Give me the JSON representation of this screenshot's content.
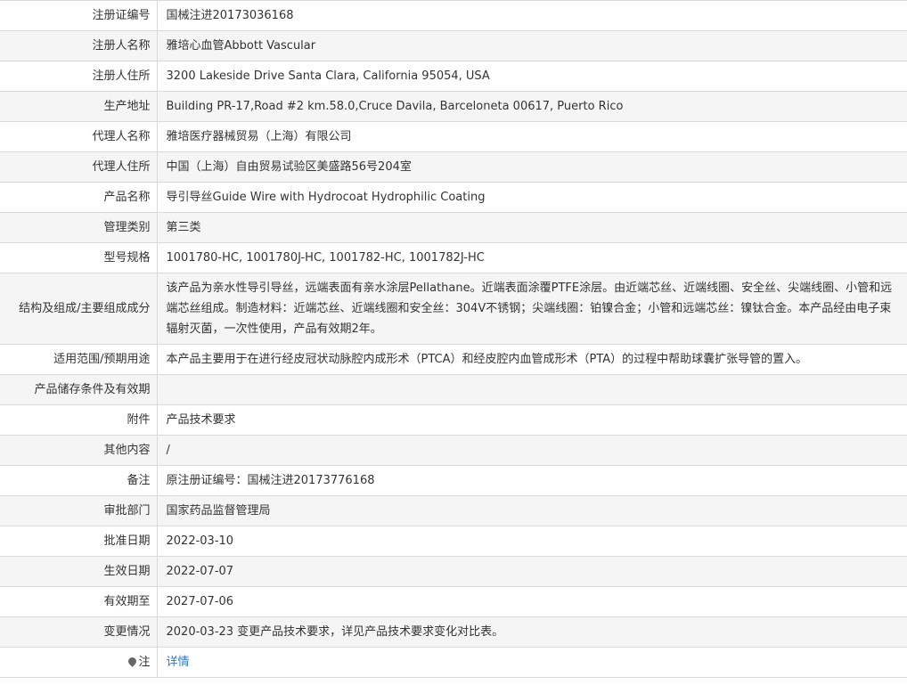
{
  "rows": [
    {
      "label": "注册证编号",
      "value": "国械注进20173036168"
    },
    {
      "label": "注册人名称",
      "value": "雅培心血管Abbott Vascular"
    },
    {
      "label": "注册人住所",
      "value": "3200 Lakeside Drive Santa Clara, California 95054, USA"
    },
    {
      "label": "生产地址",
      "value": "Building PR-17,Road #2 km.58.0,Cruce Davila, Barceloneta 00617, Puerto Rico"
    },
    {
      "label": "代理人名称",
      "value": "雅培医疗器械贸易（上海）有限公司"
    },
    {
      "label": "代理人住所",
      "value": "中国（上海）自由贸易试验区美盛路56号204室"
    },
    {
      "label": "产品名称",
      "value": "导引导丝Guide Wire with Hydrocoat Hydrophilic Coating"
    },
    {
      "label": "管理类别",
      "value": "第三类"
    },
    {
      "label": "型号规格",
      "value": "1001780-HC, 1001780J-HC, 1001782-HC, 1001782J-HC"
    },
    {
      "label": "结构及组成/主要组成成分",
      "value": "该产品为亲水性导引导丝，远端表面有亲水涂层Pellathane。近端表面涂覆PTFE涂层。由近端芯丝、近端线圈、安全丝、尖端线圈、小管和远端芯丝组成。制造材料：近端芯丝、近端线圈和安全丝：304V不锈钢；尖端线圈：铂镍合金；小管和远端芯丝：镍钛合金。本产品经由电子束辐射灭菌，一次性使用，产品有效期2年。"
    },
    {
      "label": "适用范围/预期用途",
      "value": "本产品主要用于在进行经皮冠状动脉腔内成形术（PTCA）和经皮腔内血管成形术（PTA）的过程中帮助球囊扩张导管的置入。"
    },
    {
      "label": "产品储存条件及有效期",
      "value": ""
    },
    {
      "label": "附件",
      "value": "产品技术要求"
    },
    {
      "label": "其他内容",
      "value": "/"
    },
    {
      "label": "备注",
      "value": "原注册证编号：国械注进20173776168"
    },
    {
      "label": "审批部门",
      "value": "国家药品监督管理局"
    },
    {
      "label": "批准日期",
      "value": "2022-03-10"
    },
    {
      "label": "生效日期",
      "value": "2022-07-07"
    },
    {
      "label": "有效期至",
      "value": "2027-07-06"
    },
    {
      "label": "变更情况",
      "value": "2020-03-23 变更产品技术要求，详见产品技术要求变化对比表。"
    }
  ],
  "note_row": {
    "icon": "pin-icon",
    "label": "注",
    "link_text": "详情",
    "link_color": "#2f78c4"
  }
}
